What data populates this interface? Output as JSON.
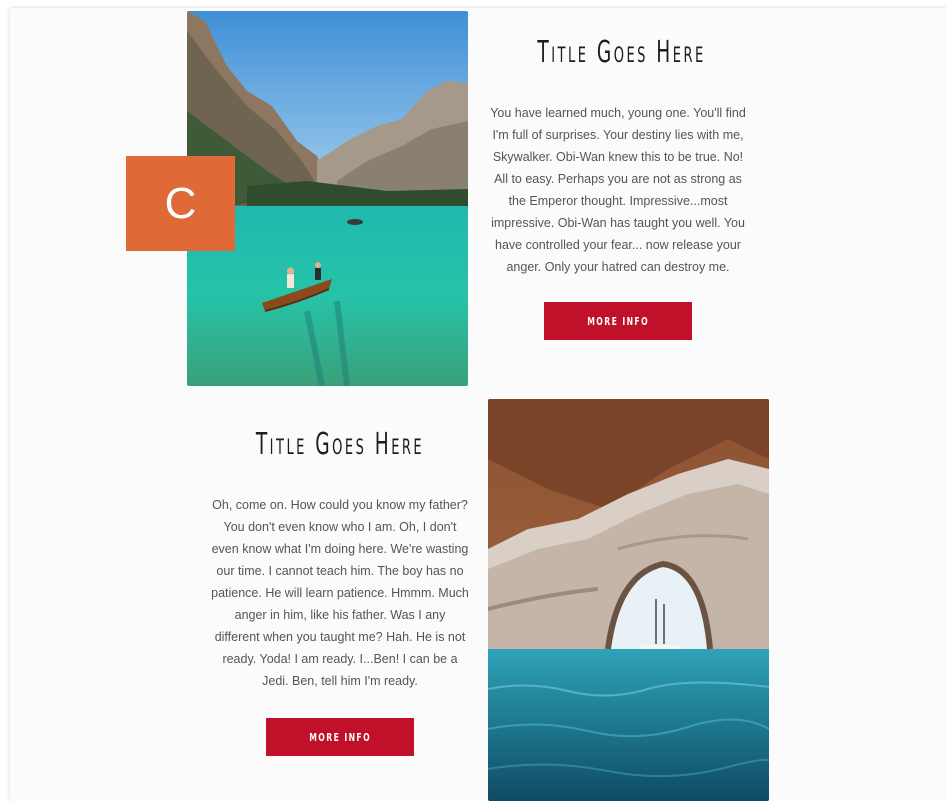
{
  "badge": {
    "letter": "C",
    "color": "#df6a38"
  },
  "accent_color": "#c0102a",
  "sections": [
    {
      "title": "Title Goes Here",
      "body": "You have learned much, young one. You'll find I'm full of surprises. Your destiny lies with me, Skywalker. Obi-Wan knew this to be true. No! All to easy. Perhaps you are not as strong as the Emperor thought. Impressive...most impressive. Obi-Wan has taught you well. You have controlled your fear... now release your anger. Only your hatred can destroy me.",
      "button_label": "MORE INFO"
    },
    {
      "title": "Title Goes Here",
      "body": "Oh, come on. How could you know my father? You don't even know who I am. Oh, I don't even know what I'm doing here. We're wasting our time. I cannot teach him. The boy has no patience. He will learn patience. Hmmm. Much anger in him, like his father. Was I any different when you taught me? Hah. He is not ready. Yoda! I am ready. I...Ben! I can be a Jedi. Ben, tell him I'm ready.",
      "button_label": "MORE INFO"
    }
  ]
}
